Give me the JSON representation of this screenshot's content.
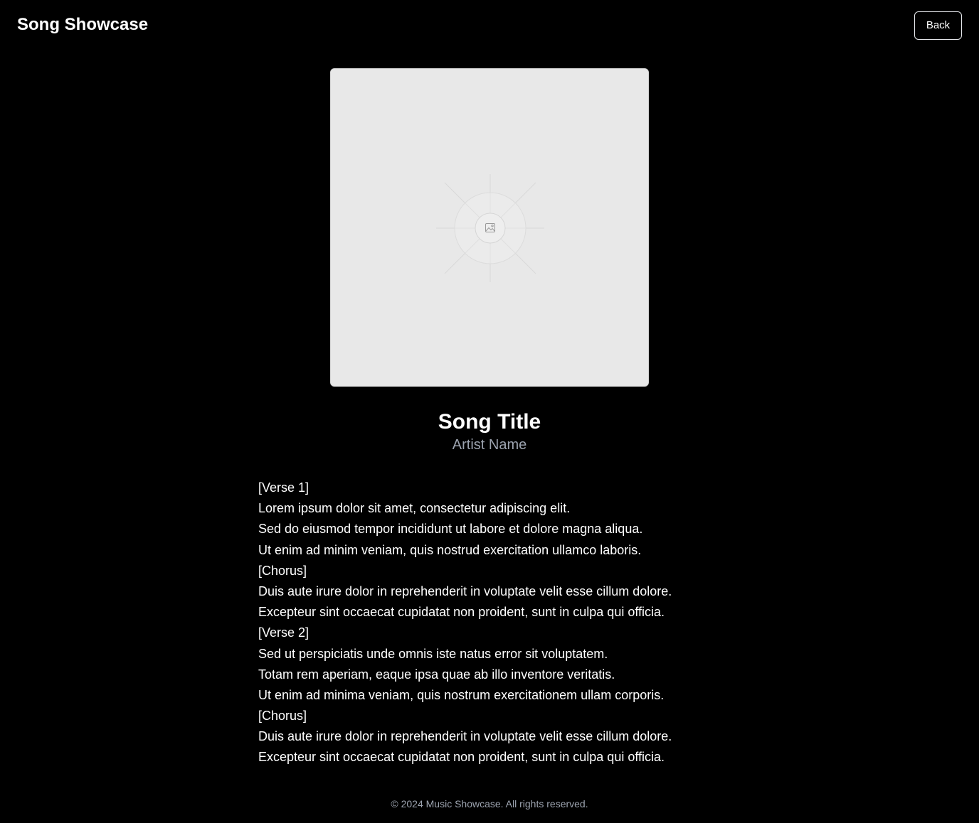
{
  "header": {
    "title": "Song Showcase",
    "back_label": "Back"
  },
  "cover": {
    "icon": "image-placeholder-icon",
    "background": "#e8e8e8"
  },
  "song": {
    "title": "Song Title",
    "artist": "Artist Name"
  },
  "lyrics": [
    "[Verse 1]",
    "Lorem ipsum dolor sit amet, consectetur adipiscing elit.",
    "Sed do eiusmod tempor incididunt ut labore et dolore magna aliqua.",
    "Ut enim ad minim veniam, quis nostrud exercitation ullamco laboris.",
    "[Chorus]",
    "Duis aute irure dolor in reprehenderit in voluptate velit esse cillum dolore.",
    "Excepteur sint occaecat cupidatat non proident, sunt in culpa qui officia.",
    "[Verse 2]",
    "Sed ut perspiciatis unde omnis iste natus error sit voluptatem.",
    "Totam rem aperiam, eaque ipsa quae ab illo inventore veritatis.",
    "Ut enim ad minima veniam, quis nostrum exercitationem ullam corporis.",
    "[Chorus]",
    "Duis aute irure dolor in reprehenderit in voluptate velit esse cillum dolore.",
    "Excepteur sint occaecat cupidatat non proident, sunt in culpa qui officia."
  ],
  "footer": {
    "text": "© 2024 Music Showcase. All rights reserved."
  },
  "colors": {
    "background": "#000000",
    "text": "#ffffff",
    "muted": "#9ca3af"
  }
}
